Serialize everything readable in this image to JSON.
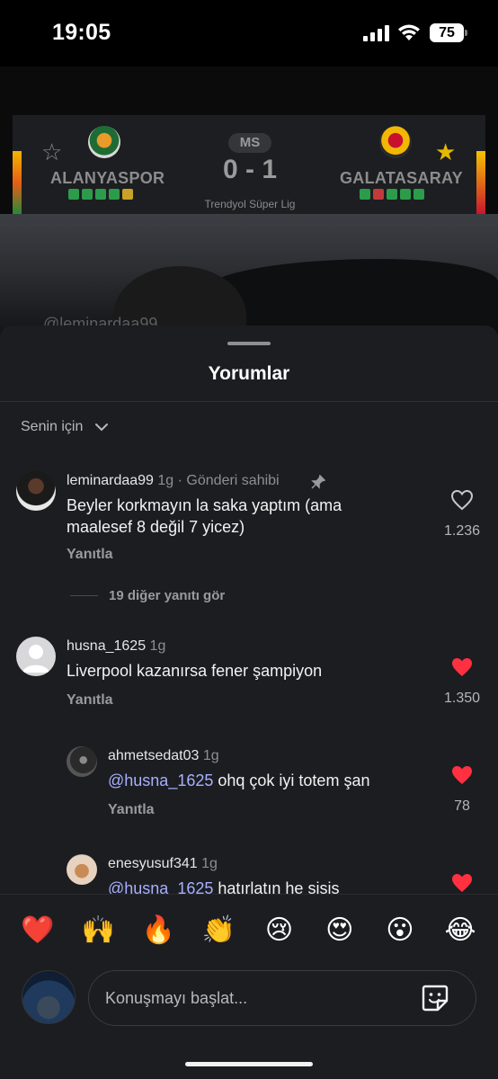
{
  "status_bar": {
    "time": "19:05",
    "battery": "75"
  },
  "scoreboard": {
    "status": "MS",
    "home_team": "ALANYASPOR",
    "away_team": "GALATASARAY",
    "score": "0 - 1",
    "league": "Trendyol Süper Lig",
    "home_form": [
      "W",
      "W",
      "W",
      "W",
      "D"
    ],
    "away_form": [
      "W",
      "L",
      "W",
      "W",
      "W"
    ]
  },
  "video": {
    "watermark": "@leminardaa99"
  },
  "sheet": {
    "title": "Yorumlar",
    "filter_label": "Senin için"
  },
  "comments": [
    {
      "username": "leminardaa99",
      "age": "1g",
      "badge": "· Gönderi sahibi",
      "text": "Beyler korkmayın la saka yaptım (ama maalesef 8 değil 7 yicez)",
      "reply_label": "Yanıtla",
      "likes": "1.236",
      "liked": false,
      "more_replies": "19 diğer yanıtı gör"
    },
    {
      "username": "husna_1625",
      "age": "1g",
      "text": "Liverpool kazanırsa fener şampiyon",
      "reply_label": "Yanıtla",
      "likes": "1.350",
      "liked": true,
      "replies": [
        {
          "username": "ahmetsedat03",
          "age": "1g",
          "mention": "@husna_1625",
          "text": " ohq çok iyi totem şan",
          "reply_label": "Yanıtla",
          "likes": "78",
          "liked": true
        },
        {
          "username": "enesyusuf341",
          "age": "1g",
          "mention": "@husna_1625",
          "text": " hatırlatın he sisis",
          "liked": true
        }
      ]
    }
  ],
  "reactions": [
    "❤️",
    "🙌",
    "🔥",
    "👏",
    "😢",
    "😍",
    "😮",
    "😂"
  ],
  "composer": {
    "placeholder": "Konuşmayı başlat..."
  },
  "colors": {
    "like_red": "#ff3040",
    "mention": "#a7b0ff",
    "sheet_bg": "#1c1d21"
  }
}
